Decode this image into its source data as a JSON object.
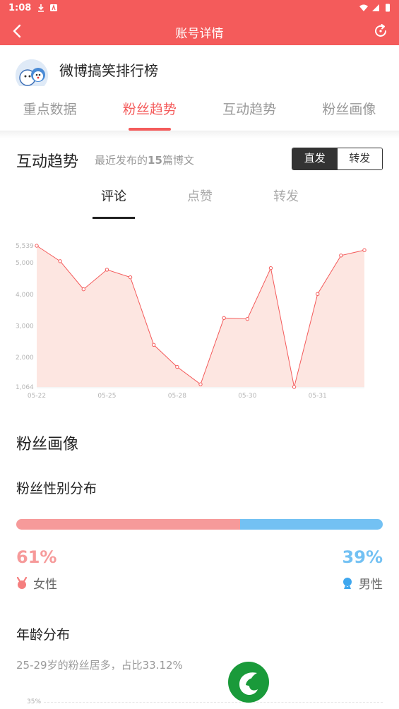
{
  "status_bar": {
    "time": "1:08"
  },
  "header": {
    "title": "账号详情"
  },
  "account": {
    "name": "微博搞笑排行榜"
  },
  "tabs": [
    {
      "label": "重点数据"
    },
    {
      "label": "粉丝趋势"
    },
    {
      "label": "互动趋势"
    },
    {
      "label": "粉丝画像"
    }
  ],
  "active_tab": "粉丝趋势",
  "interaction": {
    "title": "互动趋势",
    "subtitle_prefix": "最近发布的",
    "subtitle_count": "15",
    "subtitle_suffix": "篇博文",
    "toggle": [
      "直发",
      "转发"
    ],
    "toggle_selected": "直发",
    "sub_tabs": [
      {
        "label": "评论"
      },
      {
        "label": "点赞"
      },
      {
        "label": "转发"
      }
    ],
    "sub_tab_selected": "评论"
  },
  "chart_data": {
    "type": "area",
    "x_tick_labels": [
      "05-22",
      "05-25",
      "05-28",
      "05-30",
      "05-31"
    ],
    "y_tick_labels": [
      "1,064",
      "2,000",
      "3,000",
      "4,000",
      "5,000",
      "5,539"
    ],
    "ylim": [
      1064,
      5539
    ],
    "values": [
      5539,
      5050,
      4160,
      4780,
      4540,
      2400,
      1700,
      1150,
      3250,
      3220,
      4830,
      1064,
      4010,
      5230,
      5400
    ],
    "colors": {
      "line": "#f45b5b",
      "fill": "#fde6e1",
      "axis_text": "#b5b5b5"
    }
  },
  "fan_profile": {
    "title": "粉丝画像",
    "gender": {
      "title": "粉丝性别分布",
      "female_pct": "61%",
      "male_pct": "39%",
      "female_fraction": 0.61,
      "female_label": "女性",
      "male_label": "男性",
      "female_color": "#f69a9a",
      "male_color": "#73c1f3"
    },
    "age": {
      "title": "年龄分布",
      "summary": "25-29岁的粉丝居多，占比33.12%",
      "axis_top_label": "35%"
    }
  }
}
